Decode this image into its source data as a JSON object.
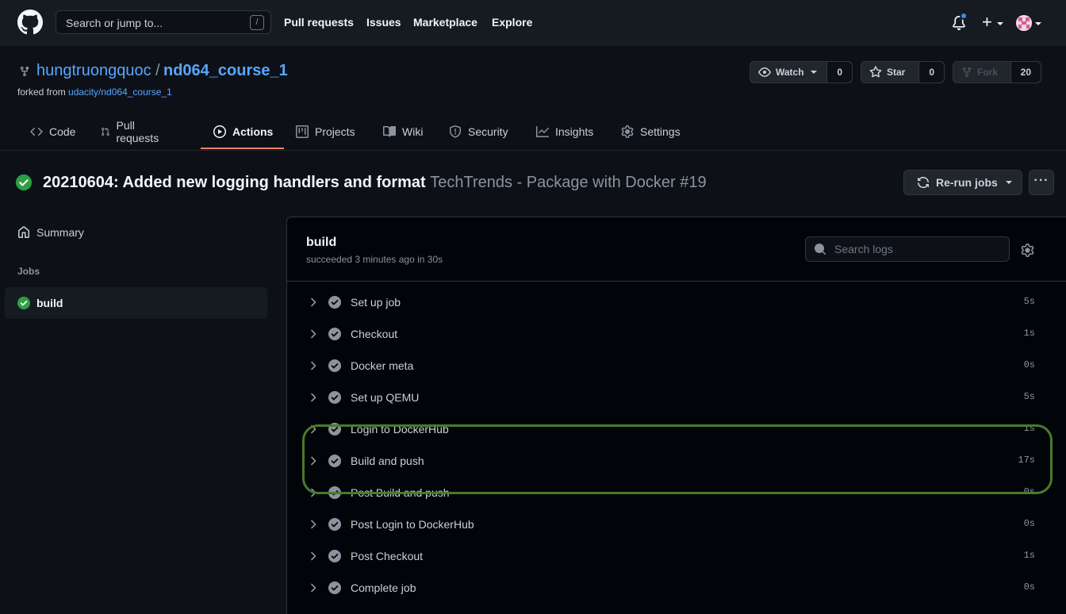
{
  "header": {
    "search_placeholder": "Search or jump to...",
    "search_shortcut": "/",
    "nav": [
      "Pull requests",
      "Issues",
      "Marketplace",
      "Explore"
    ]
  },
  "repo": {
    "owner": "hungtruongquoc",
    "separator": "/",
    "name": "nd064_course_1",
    "forked_label": "forked from",
    "forked_from": "udacity/nd064_course_1",
    "watch": {
      "label": "Watch",
      "count": "0"
    },
    "star": {
      "label": "Star",
      "count": "0"
    },
    "fork": {
      "label": "Fork",
      "count": "20"
    }
  },
  "tabs": [
    {
      "label": "Code",
      "icon": "code-icon"
    },
    {
      "label": "Pull requests",
      "icon": "pull-request-icon"
    },
    {
      "label": "Actions",
      "icon": "play-icon",
      "active": true
    },
    {
      "label": "Projects",
      "icon": "project-icon"
    },
    {
      "label": "Wiki",
      "icon": "book-icon"
    },
    {
      "label": "Security",
      "icon": "shield-icon"
    },
    {
      "label": "Insights",
      "icon": "graph-icon"
    },
    {
      "label": "Settings",
      "icon": "gear-icon"
    }
  ],
  "run": {
    "title": "20210604: Added new logging handlers and format",
    "subtitle": "TechTrends - Package with Docker #19",
    "rerun_label": "Re-run jobs",
    "more_label": "···"
  },
  "sidebar": {
    "summary": "Summary",
    "jobs_heading": "Jobs",
    "jobs": [
      {
        "label": "build",
        "status": "success"
      }
    ]
  },
  "log": {
    "job_name": "build",
    "status": "succeeded 3 minutes ago in 30s",
    "search_placeholder": "Search logs",
    "steps": [
      {
        "name": "Set up job",
        "duration": "5s"
      },
      {
        "name": "Checkout",
        "duration": "1s"
      },
      {
        "name": "Docker meta",
        "duration": "0s"
      },
      {
        "name": "Set up QEMU",
        "duration": "5s"
      },
      {
        "name": "Login to DockerHub",
        "duration": "1s"
      },
      {
        "name": "Build and push",
        "duration": "17s"
      },
      {
        "name": "Post Build and push",
        "duration": "0s"
      },
      {
        "name": "Post Login to DockerHub",
        "duration": "0s"
      },
      {
        "name": "Post Checkout",
        "duration": "1s"
      },
      {
        "name": "Complete job",
        "duration": "0s"
      }
    ]
  },
  "colors": {
    "success": "#2ea043",
    "link": "#58a6ff",
    "active_tab_underline": "#f78166",
    "highlight_annotation": "#4a7a2a"
  }
}
